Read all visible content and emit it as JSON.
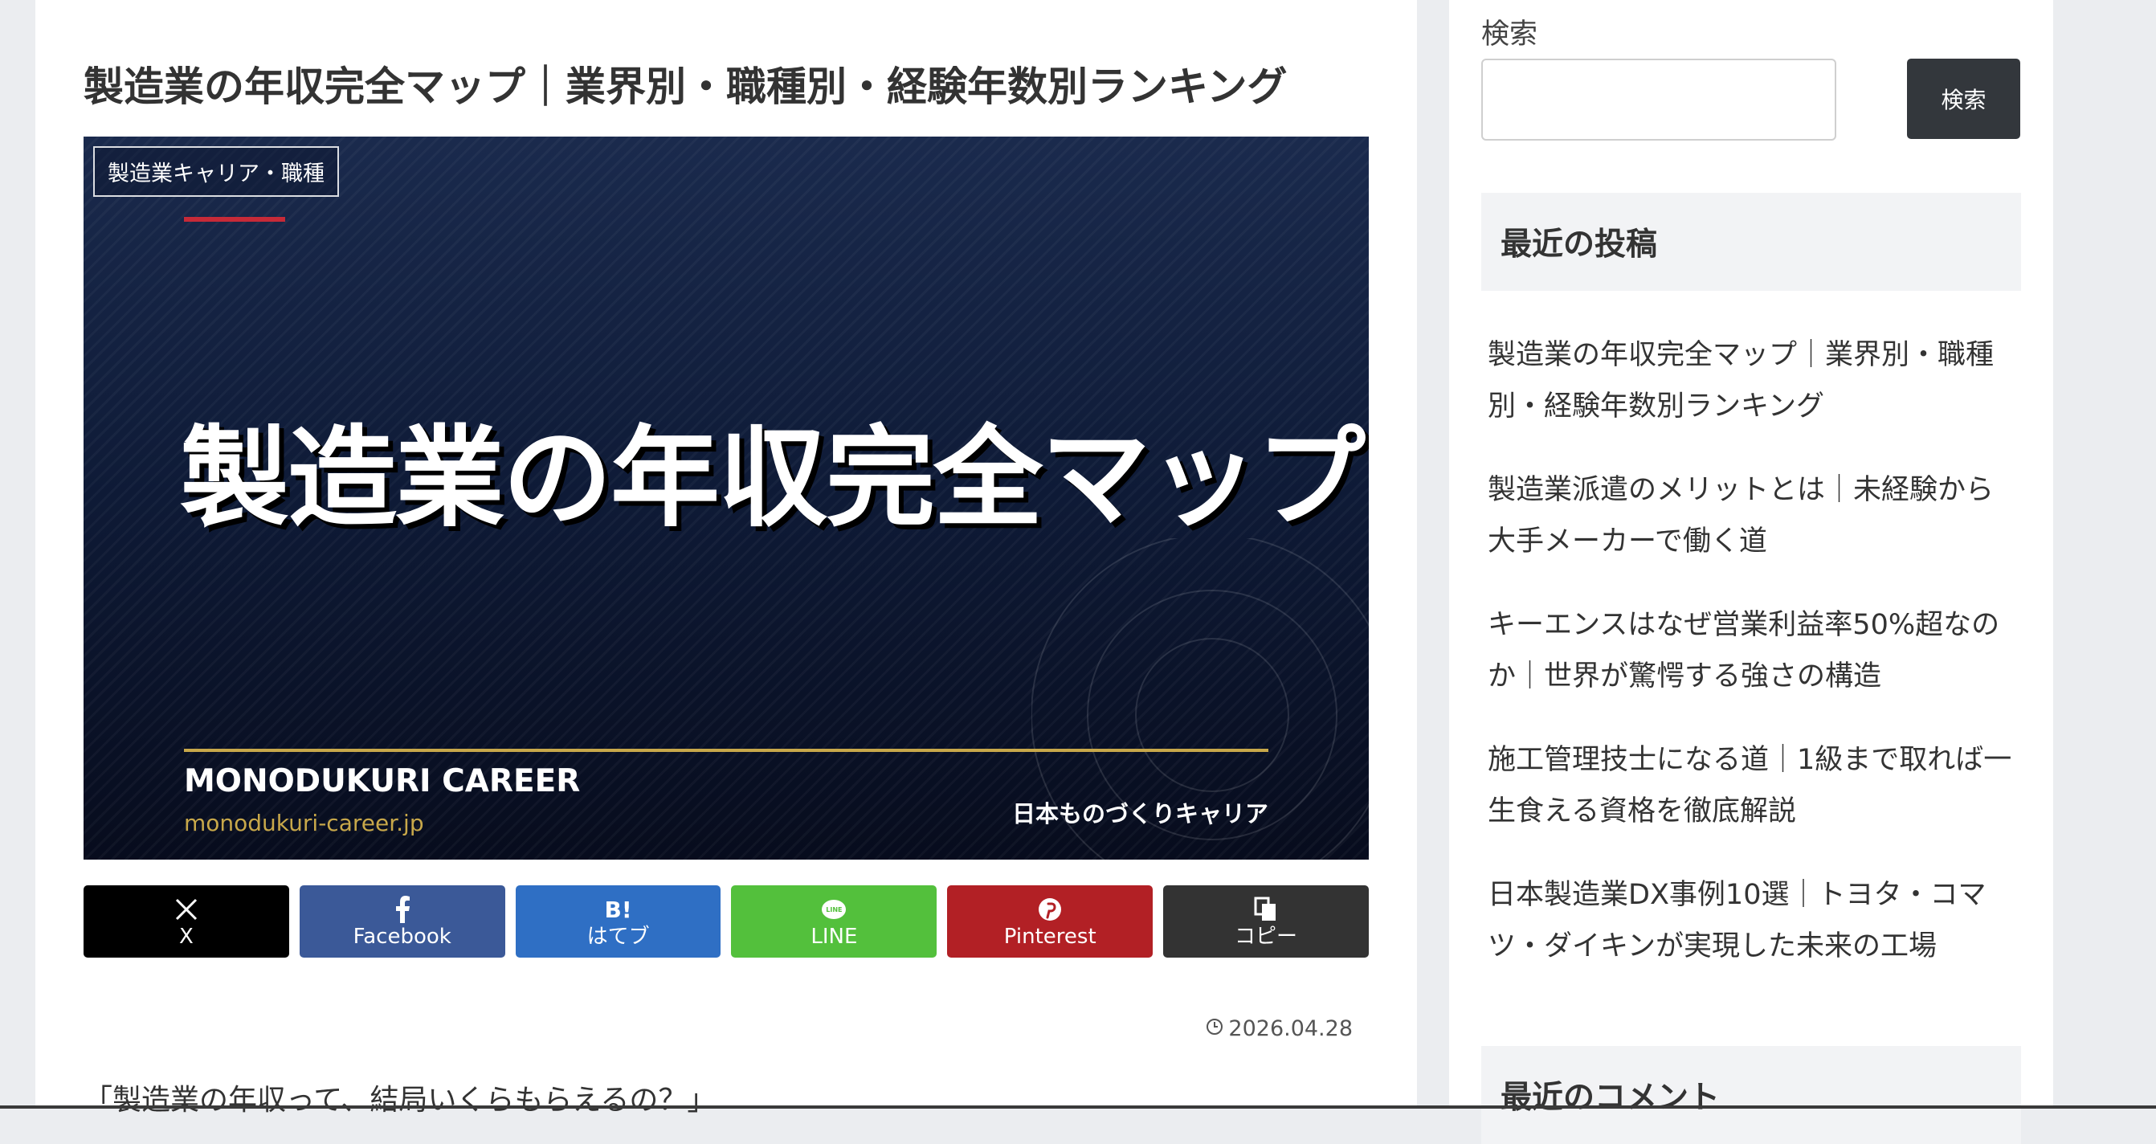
{
  "article": {
    "title": "製造業の年収完全マップ｜業界別・職種別・経験年数別ランキング",
    "eyecatch": {
      "category_label": "製造業キャリア・職種",
      "headline": "製造業の年収完全マップ",
      "brand_name": "MONODUKURI CAREER",
      "brand_url": "monodukuri-career.jp",
      "brand_jp": "日本ものづくりキャリア"
    },
    "share_buttons": [
      {
        "label": "X",
        "icon": "x-logo-icon",
        "color": "#000000"
      },
      {
        "label": "Facebook",
        "icon": "facebook-icon",
        "color": "#3b5998"
      },
      {
        "label": "はてブ",
        "icon": "hatena-bookmark-icon",
        "glyph": "B!",
        "color": "#2f6fc4"
      },
      {
        "label": "LINE",
        "icon": "line-icon",
        "glyph": "LINE",
        "color": "#53c03c"
      },
      {
        "label": "Pinterest",
        "icon": "pinterest-icon",
        "color": "#b22025"
      },
      {
        "label": "コピー",
        "icon": "copy-icon",
        "color": "#333333"
      }
    ],
    "date": "2026.04.28",
    "intro_fragment": "「製造業の年収って、結局いくらもらえるの？」"
  },
  "sidebar": {
    "search": {
      "label": "検索",
      "button": "検索",
      "value": ""
    },
    "recent_posts": {
      "heading": "最近の投稿",
      "items": [
        "製造業の年収完全マップ｜業界別・職種別・経験年数別ランキング",
        "製造業派遣のメリットとは｜未経験から大手メーカーで働く道",
        "キーエンスはなぜ営業利益率50%超なのか｜世界が驚愕する強さの構造",
        "施工管理技士になる道｜1級まで取れば一生食える資格を徹底解説",
        "日本製造業DX事例10選｜トヨタ・コマツ・ダイキンが実現した未来の工場"
      ]
    },
    "recent_comments": {
      "heading": "最近のコメント"
    }
  },
  "colors": {
    "eyecatch_accent_red": "#c62a38",
    "eyecatch_gold": "#c8a84a",
    "search_button": "#33373c"
  }
}
